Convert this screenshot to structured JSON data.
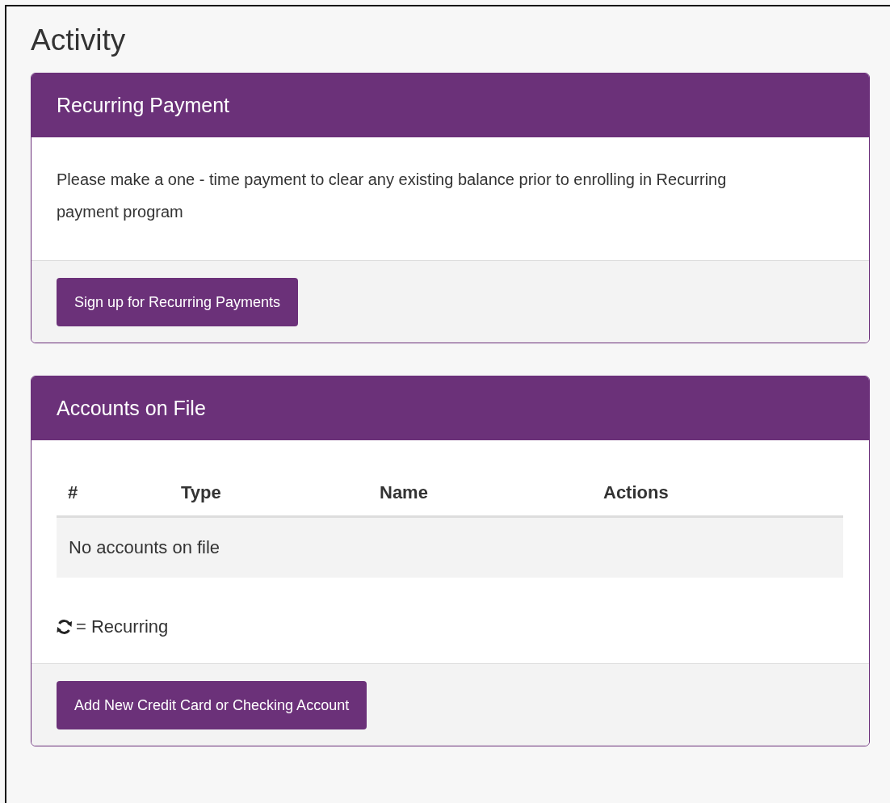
{
  "page": {
    "title": "Activity"
  },
  "recurring_panel": {
    "title": "Recurring Payment",
    "message": "Please make a one - time payment to clear any existing balance prior to enrolling in Recurring payment program",
    "button": "Sign up for Recurring Payments"
  },
  "accounts_panel": {
    "title": "Accounts on File",
    "table": {
      "columns": [
        "#",
        "Type",
        "Name",
        "Actions"
      ],
      "empty_message": "No accounts on file"
    },
    "legend": "= Recurring",
    "button": "Add New Credit Card or Checking Account"
  }
}
